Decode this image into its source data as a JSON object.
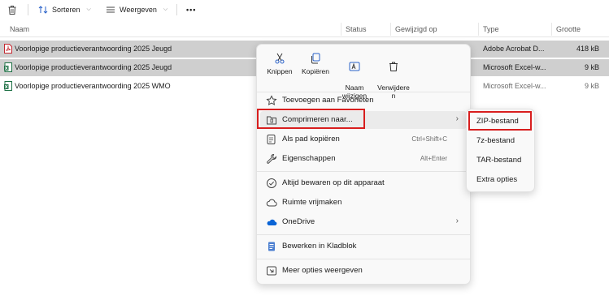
{
  "toolbar": {
    "sort_label": "Sorteren",
    "view_label": "Weergeven",
    "more_label": "•••"
  },
  "columns": {
    "name": "Naam",
    "status": "Status",
    "modified": "Gewijzigd op",
    "type": "Type",
    "size": "Grootte"
  },
  "files": [
    {
      "name": "Voorlopige productieverantwoording 2025 Jeugd",
      "type": "Adobe Acrobat D...",
      "size": "418 kB",
      "icon": "pdf-icon",
      "selected": true
    },
    {
      "name": "Voorlopige productieverantwoording 2025 Jeugd",
      "type": "Microsoft Excel-w...",
      "size": "9 kB",
      "icon": "excel-icon",
      "selected": true
    },
    {
      "name": "Voorlopige productieverantwoording 2025 WMO",
      "type": "Microsoft Excel-w...",
      "size": "9 kB",
      "icon": "excel-icon",
      "selected": false
    }
  ],
  "context_menu": {
    "quick_actions": [
      {
        "label": "Knippen",
        "icon": "scissors-icon"
      },
      {
        "label": "Kopiëren",
        "icon": "copy-icon"
      },
      {
        "label": "Naam\nwijzigen",
        "icon": "rename-icon"
      },
      {
        "label": "Verwijdere\nn",
        "icon": "trash-icon"
      }
    ],
    "items": [
      {
        "label": "Toevoegen aan Favorieten",
        "shortcut": "",
        "icon": "star-icon"
      },
      {
        "label": "Comprimeren naar...",
        "shortcut": "",
        "icon": "archive-icon",
        "submenu": true
      },
      {
        "label": "Als pad kopiëren",
        "shortcut": "Ctrl+Shift+C",
        "icon": "path-icon"
      },
      {
        "label": "Eigenschappen",
        "shortcut": "Alt+Enter",
        "icon": "wrench-icon"
      },
      {
        "label": "Altijd bewaren op dit apparaat",
        "shortcut": "",
        "icon": "check-circle-icon"
      },
      {
        "label": "Ruimte vrijmaken",
        "shortcut": "",
        "icon": "cloud-icon"
      },
      {
        "label": "OneDrive",
        "shortcut": "",
        "icon": "onedrive-icon",
        "submenu": true
      },
      {
        "label": "Bewerken in Kladblok",
        "shortcut": "",
        "icon": "notepad-icon"
      },
      {
        "label": "Meer opties weergeven",
        "shortcut": "",
        "icon": "more-options-icon"
      }
    ]
  },
  "submenu": {
    "items": [
      {
        "label": "ZIP-bestand"
      },
      {
        "label": "7z-bestand"
      },
      {
        "label": "TAR-bestand"
      },
      {
        "label": "Extra opties"
      }
    ]
  },
  "colors": {
    "highlight_box": "#d81e1e",
    "selection": "#cfcfcf",
    "pdf_red": "#c4272f",
    "excel_green": "#1d7044",
    "onedrive_blue": "#0a64d6"
  }
}
